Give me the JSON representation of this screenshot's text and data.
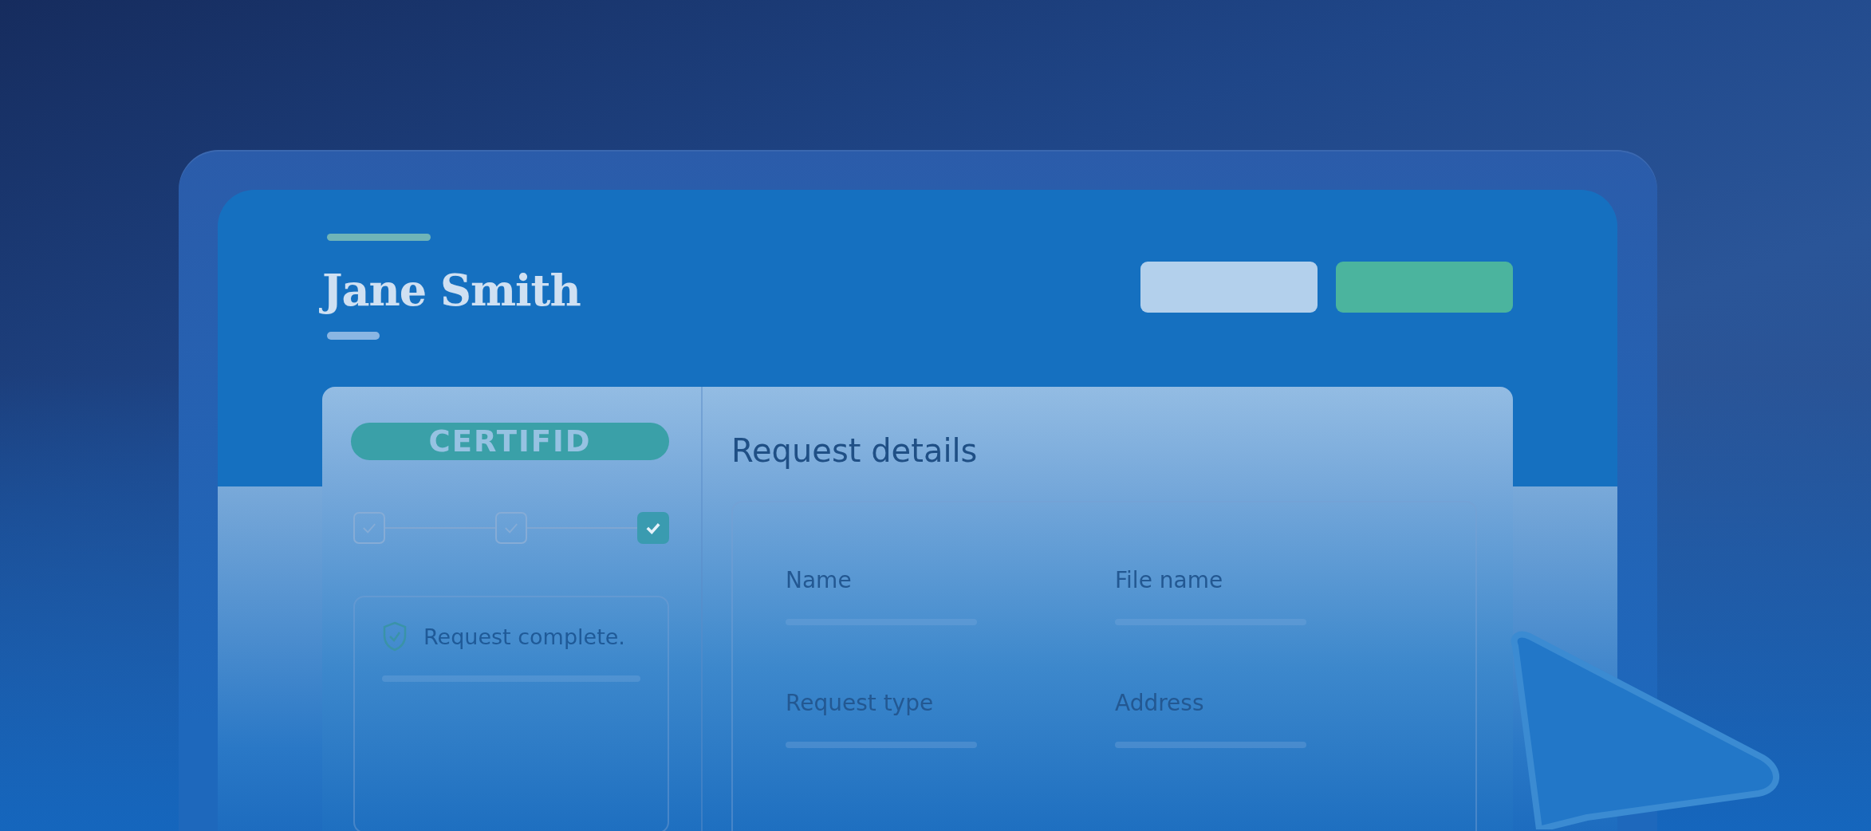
{
  "profile": {
    "name": "Jane Smith"
  },
  "header_buttons": [
    {
      "kind": "secondary"
    },
    {
      "kind": "primary"
    }
  ],
  "brand": {
    "label": "CERTIFID"
  },
  "steps": [
    {
      "selected": false
    },
    {
      "selected": false
    },
    {
      "selected": true
    }
  ],
  "status": {
    "message": "Request complete."
  },
  "details": {
    "title": "Request details",
    "fields": [
      {
        "label": "Name"
      },
      {
        "label": "File name"
      },
      {
        "label": "Request type"
      },
      {
        "label": "Address"
      }
    ]
  }
}
